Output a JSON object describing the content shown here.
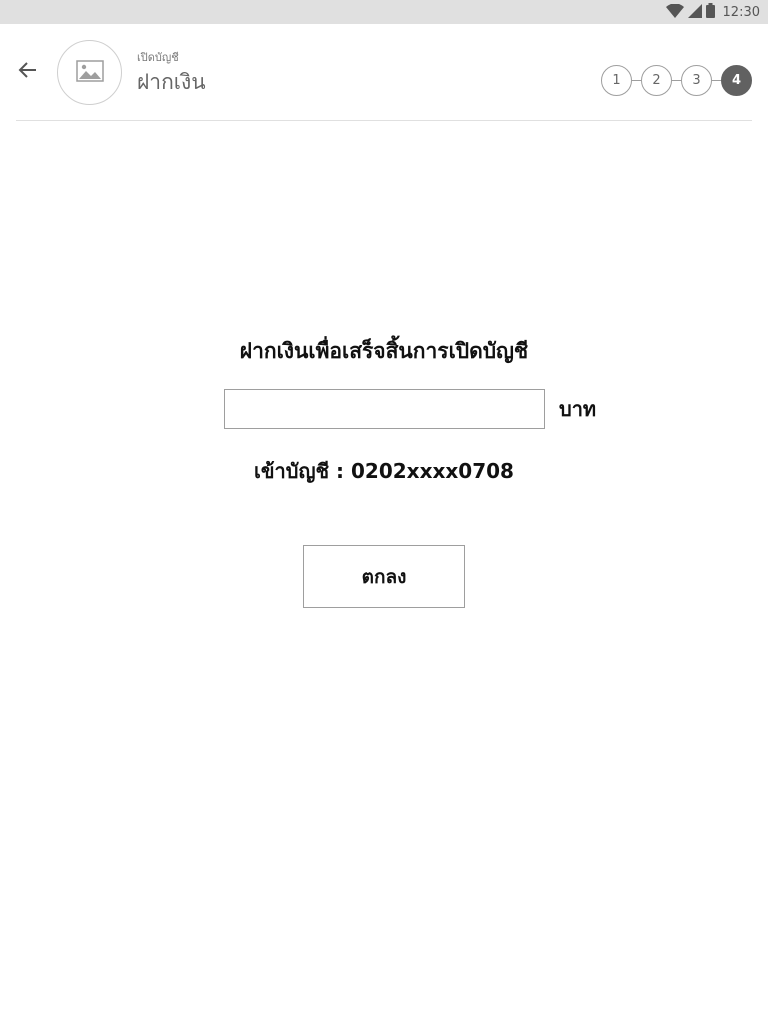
{
  "status_bar": {
    "time": "12:30",
    "icons": [
      "wifi-icon",
      "cellular-signal-icon",
      "battery-icon"
    ]
  },
  "header": {
    "back_icon": "arrow-left-icon",
    "avatar_icon": "image-placeholder-icon",
    "subtitle": "เปิดบัญชี",
    "title": "ฝากเงิน",
    "steps": [
      {
        "label": "1",
        "active": false
      },
      {
        "label": "2",
        "active": false
      },
      {
        "label": "3",
        "active": false
      },
      {
        "label": "4",
        "active": true
      }
    ]
  },
  "main": {
    "heading": "ฝากเงินเพื่อเสร็จสิ้นการเปิดบัญชี",
    "amount": {
      "value": "",
      "placeholder": ""
    },
    "currency": "บาท",
    "account_line": "เข้าบัญชี : 0202xxxx0708",
    "confirm_label": "ตกลง"
  },
  "colors": {
    "status_bar_bg": "#e0e0e0",
    "active_step": "#616161",
    "border": "#9e9e9e"
  }
}
